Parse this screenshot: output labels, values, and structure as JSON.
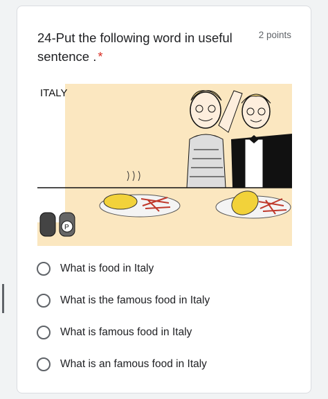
{
  "question": {
    "title": "24-Put the following word in useful sentence .",
    "required_mark": "*",
    "points": "2 points",
    "image": {
      "caption": "ITALY"
    },
    "options": [
      {
        "label": "What is food in Italy",
        "selected": false
      },
      {
        "label": "What is the famous food in Italy",
        "selected": false
      },
      {
        "label": "What is famous food in Italy",
        "selected": false
      },
      {
        "label": "What is an famous food in Italy",
        "selected": false
      }
    ]
  },
  "colors": {
    "required": "#d93025",
    "radio_border": "#5f6368",
    "card_border": "#dadce0",
    "illustration_bg": "#fbe7c0"
  }
}
